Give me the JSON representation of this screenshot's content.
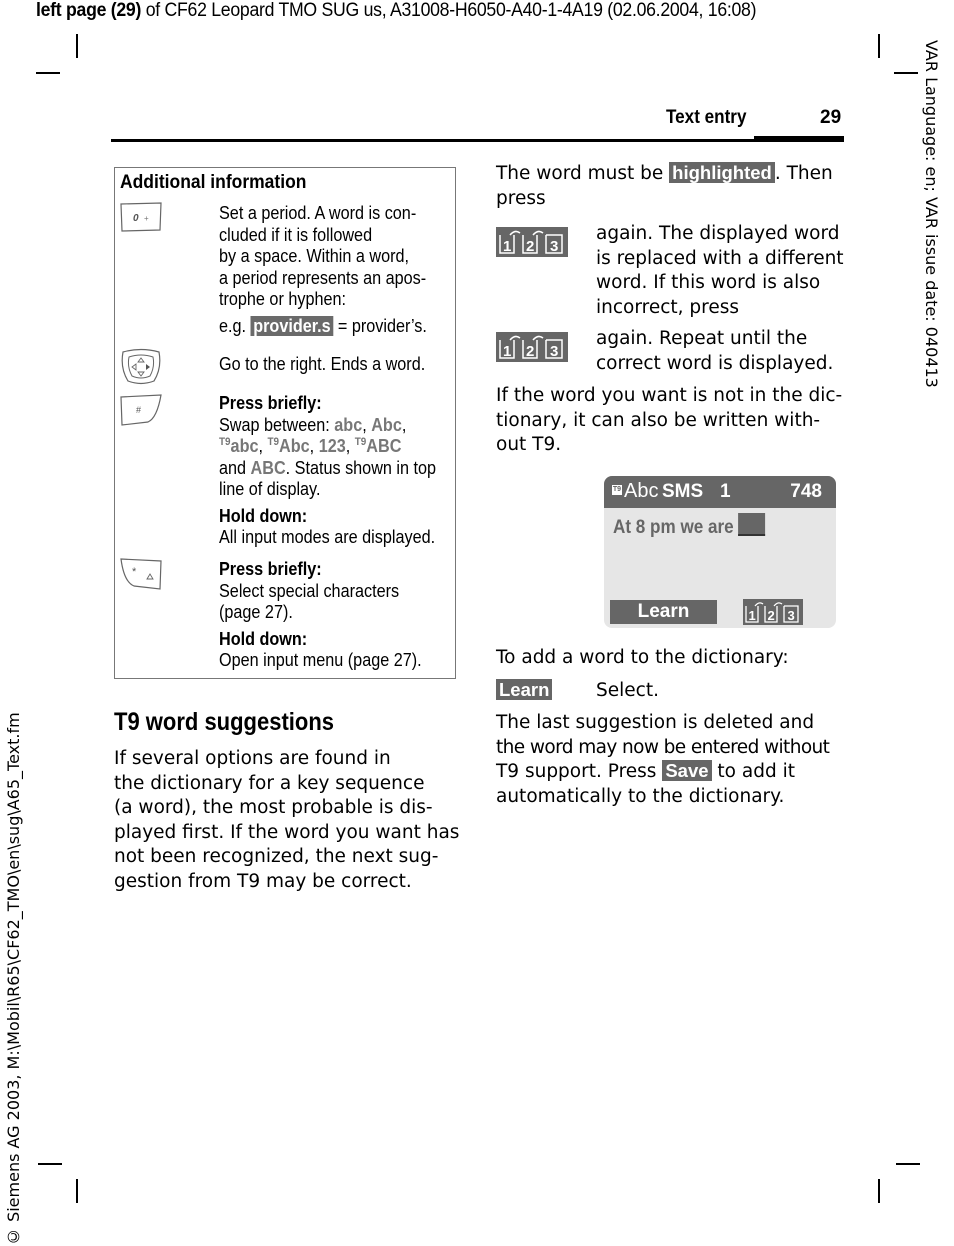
{
  "banner": {
    "bold_part": "left page (29)",
    "rest": " of CF62 Leopard TMO SUG us, A31008-H6050-A40-1-4A19 (02.06.2004, 16:08)"
  },
  "side_right": "VAR Language: en; VAR issue date: 040413",
  "side_left": "© Siemens AG 2003, M:\\Mobil\\R65\\CF62_TMO\\en\\sug\\A65_Text.fm",
  "header": {
    "section": "Text entry",
    "page": "29"
  },
  "info_box": {
    "title": "Additional information",
    "rows": [
      {
        "key_icon": "key-0-plus-icon",
        "key_label": "0 +",
        "lines": [
          "Set a period. A word is con-",
          "cluded if it is followed",
          "by a space. Within a word,",
          "a period  represents an apos-",
          "trophe or hyphen:"
        ],
        "example_prefix": "e.g. ",
        "example_highlight": "provider.s",
        "example_suffix": " = provider’s."
      },
      {
        "key_icon": "navigation-key-icon",
        "lines": [
          "Go to the right. Ends a word."
        ]
      },
      {
        "key_icon": "key-hash-icon",
        "key_label": "#",
        "press_briefly": "Press briefly:",
        "swap_prefix": "Swap between: ",
        "modes": [
          "abc",
          "Abc",
          "abc",
          "Abc",
          "123",
          "ABC",
          "ABC"
        ],
        "t9_sup": "T9",
        "and_word": "and ",
        "status_text": ". Status shown in top",
        "status_text2": "line of display.",
        "hold_down": "Hold down:",
        "hold_text": "All input modes are displayed."
      },
      {
        "key_icon": "key-star-icon",
        "key_label": "*",
        "press_briefly": "Press briefly:",
        "press_lines": [
          "Select special characters",
          "(page 27)."
        ],
        "hold_down": "Hold down:",
        "hold_text": "Open input menu (page 27)."
      }
    ]
  },
  "t9_section": {
    "heading": "T9 word suggestions",
    "lines": [
      "If several options are found in",
      "the dictionary for a key sequence",
      "(a word), the most probable is dis-",
      "played first. If the word you want has",
      "not been recognized, the next sug-",
      "gestion from T9 may be correct."
    ]
  },
  "right_column": {
    "intro_prefix": "The word must be ",
    "intro_highlight": "highlighted",
    "intro_suffix": ". Then",
    "intro_line2": "press",
    "step1_lines": [
      "again. The displayed word",
      "is replaced with a different",
      "word. If this word is also",
      "incorrect, press"
    ],
    "step2_lines": [
      "again. Repeat until the",
      "correct word is displayed."
    ],
    "t9_key_digits": [
      "1",
      "2",
      "3"
    ],
    "no_dict_lines": [
      "If the word you want is not in the dic-",
      "tionary, it can also be written with-",
      "out T9."
    ],
    "display": {
      "t9_badge": "T9",
      "mode": "Abc",
      "app": "SMS",
      "count": "1",
      "chars_left": "748",
      "text": "At 8 pm we are",
      "softkey_left": "Learn"
    },
    "add_word_intro": "To add a word to the dictionary:",
    "learn_softkey": "Learn",
    "learn_action": "Select.",
    "final_lines_1": [
      "The last suggestion is deleted and",
      "the word may now be entered without"
    ],
    "final_prefix": "T9 support. Press ",
    "save_softkey": "Save",
    "final_suffix": " to add it",
    "final_last": "automatically to the dictionary."
  }
}
